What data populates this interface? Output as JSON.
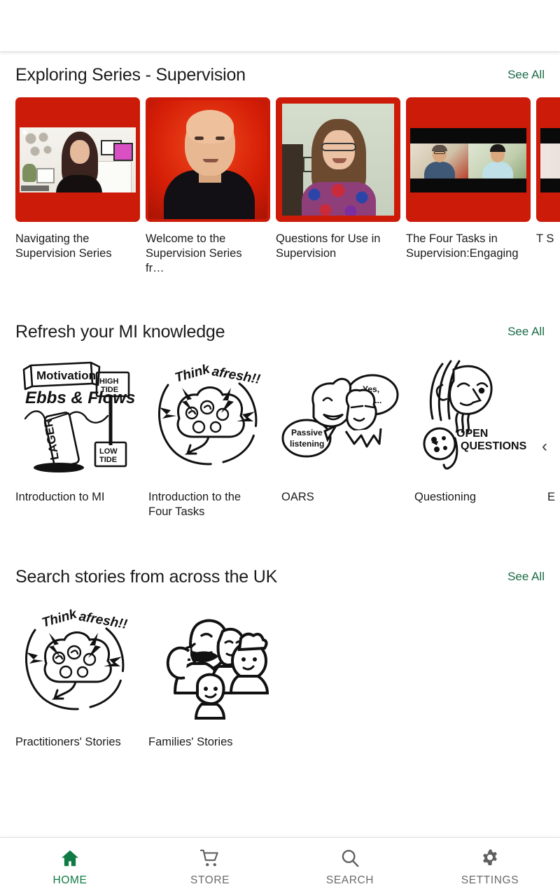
{
  "app": {
    "appbar_title": "",
    "accent_green": "#1a6b46",
    "active_green": "#0f7a44",
    "thumb_red": "#CC1B09"
  },
  "sections": [
    {
      "id": "exploring-series-supervision",
      "title": "Exploring Series - Supervision",
      "see_all_label": "See All",
      "type": "video",
      "cards": [
        {
          "title": "Navigating the Supervision Series",
          "thumb": "woman-home-office-video"
        },
        {
          "title": "Welcome to the Supervision Series fr…",
          "thumb": "bald-man-portrait"
        },
        {
          "title": "Questions for Use in Supervision",
          "thumb": "woman-glasses-video"
        },
        {
          "title": "The Four Tasks in Supervision:Engaging",
          "thumb": "two-men-split-call"
        },
        {
          "title": "T S",
          "thumb": "partial-card"
        }
      ]
    },
    {
      "id": "refresh-your-mi-knowledge",
      "title": "Refresh your MI knowledge",
      "see_all_label": "See All",
      "type": "illustration",
      "scroll_hint": "‹",
      "cards": [
        {
          "title": "Introduction to MI",
          "thumb": "motivation-ebbs-and-flows-illustration",
          "art_text": [
            "Motivation",
            "Ebbs & Flows",
            "HIGH TIDE",
            "LOW TIDE",
            "LAGER"
          ]
        },
        {
          "title": "Introduction to the Four Tasks",
          "thumb": "think-afresh-brain-illustration",
          "art_text": [
            "Think afresh!!"
          ]
        },
        {
          "title": "OARS",
          "thumb": "passive-listening-illustration",
          "art_text": [
            "Passive listening",
            "Yes, mm..."
          ]
        },
        {
          "title": "Questioning",
          "thumb": "open-questions-illustration",
          "art_text": [
            "OPEN",
            "QUESTIONS"
          ]
        },
        {
          "title": "E",
          "thumb": "partial-illustration",
          "art_text": []
        }
      ]
    },
    {
      "id": "search-stories-from-across-the-uk",
      "title": "Search stories from across the UK",
      "see_all_label": "See All",
      "type": "illustration",
      "cards": [
        {
          "title": "Practitioners' Stories",
          "thumb": "think-afresh-brain-illustration",
          "art_text": [
            "Think afresh!!"
          ]
        },
        {
          "title": "Families' Stories",
          "thumb": "family-faces-illustration",
          "art_text": []
        }
      ]
    }
  ],
  "bottom_nav": {
    "items": [
      {
        "label": "HOME",
        "icon": "home-icon",
        "active": true
      },
      {
        "label": "STORE",
        "icon": "cart-icon",
        "active": false
      },
      {
        "label": "SEARCH",
        "icon": "search-icon",
        "active": false
      },
      {
        "label": "SETTINGS",
        "icon": "gear-icon",
        "active": false
      }
    ]
  }
}
